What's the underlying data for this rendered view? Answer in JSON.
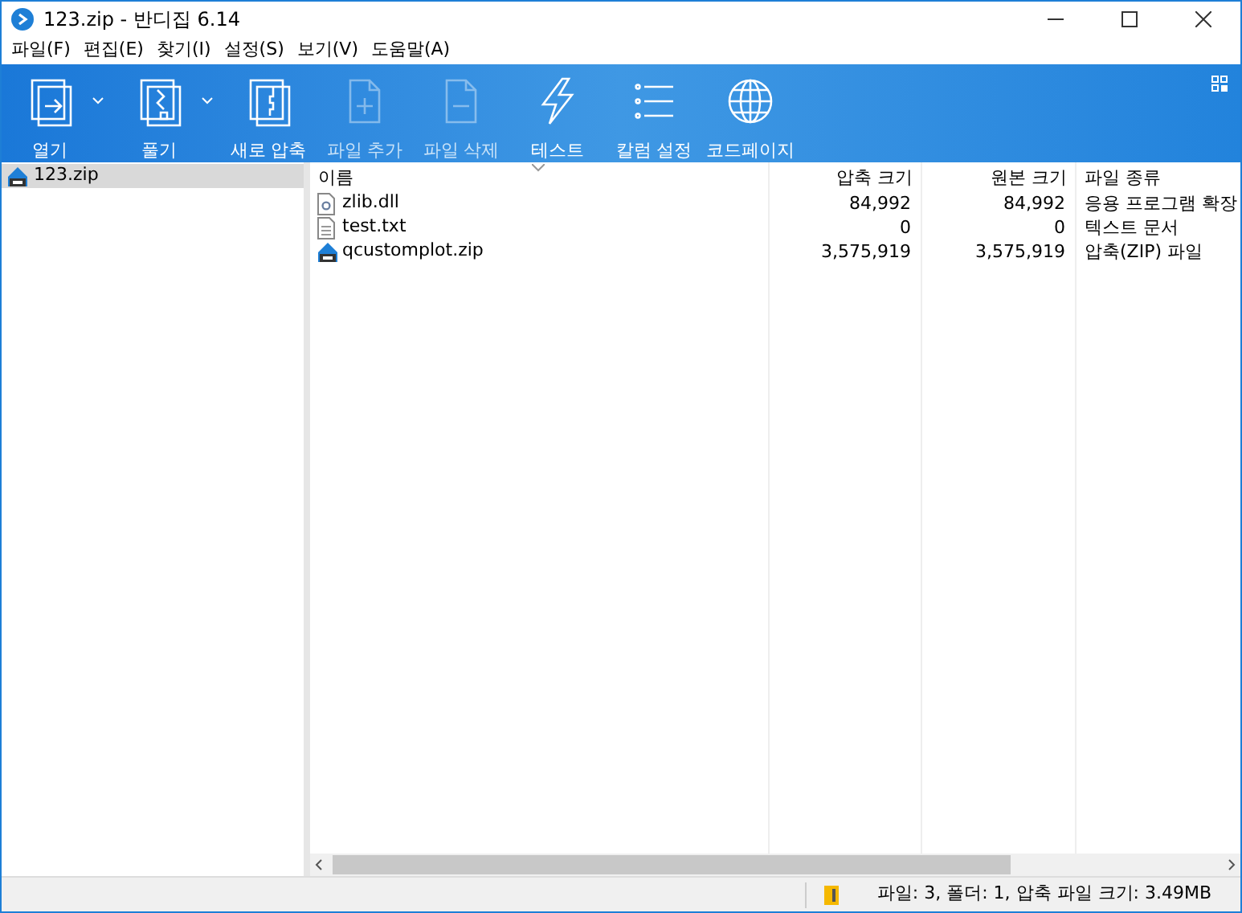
{
  "window": {
    "title": "123.zip - 반디집 6.14"
  },
  "menu": [
    "파일(F)",
    "편집(E)",
    "찾기(I)",
    "설정(S)",
    "보기(V)",
    "도움말(A)"
  ],
  "toolbar": [
    {
      "label": "열기",
      "kind": "open",
      "dropdown": true,
      "disabled": false
    },
    {
      "label": "풀기",
      "kind": "extract",
      "dropdown": true,
      "disabled": false
    },
    {
      "label": "새로 압축",
      "kind": "new",
      "dropdown": false,
      "disabled": false
    },
    {
      "label": "파일 추가",
      "kind": "add",
      "dropdown": false,
      "disabled": true
    },
    {
      "label": "파일 삭제",
      "kind": "delete",
      "dropdown": false,
      "disabled": true
    },
    {
      "label": "테스트",
      "kind": "test",
      "dropdown": false,
      "disabled": false
    },
    {
      "label": "칼럼 설정",
      "kind": "columns",
      "dropdown": false,
      "disabled": false
    },
    {
      "label": "코드페이지",
      "kind": "codepage",
      "dropdown": false,
      "disabled": false
    }
  ],
  "tree": [
    {
      "label": "123.zip",
      "selected": true
    }
  ],
  "table": {
    "columns": [
      "이름",
      "압축 크기",
      "원본 크기",
      "파일 종류"
    ],
    "rows": [
      {
        "kind": "dll",
        "name": "zlib.dll",
        "compressed": "84,992",
        "original": "84,992",
        "type": "응용 프로그램 확장"
      },
      {
        "kind": "txt",
        "name": "test.txt",
        "compressed": "0",
        "original": "0",
        "type": "텍스트 문서"
      },
      {
        "kind": "zip",
        "name": "qcustomplot.zip",
        "compressed": "3,575,919",
        "original": "3,575,919",
        "type": "압축(ZIP) 파일"
      }
    ]
  },
  "status_bar": "파일: 3, 폴더: 1, 압축 파일 크기: 3.49MB"
}
